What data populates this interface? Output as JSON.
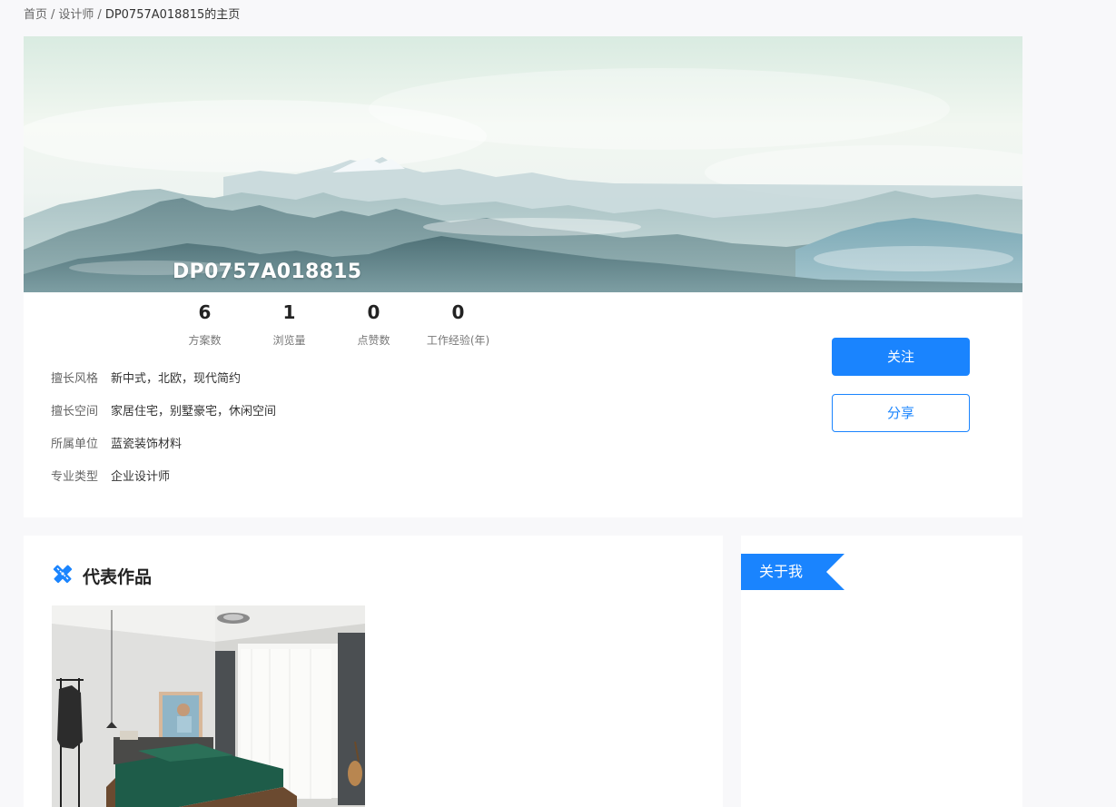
{
  "breadcrumb": {
    "home": "首页",
    "designers": "设计师",
    "current": "DP0757A018815的主页",
    "separator": "/"
  },
  "profile": {
    "name": "DP0757A018815",
    "stats": [
      {
        "value": "6",
        "label": "方案数"
      },
      {
        "value": "1",
        "label": "浏览量"
      },
      {
        "value": "0",
        "label": "点赞数"
      },
      {
        "value": "0",
        "label": "工作经验(年)"
      }
    ],
    "info": [
      {
        "key": "擅长风格",
        "value": "新中式，北欧，现代简约"
      },
      {
        "key": "擅长空间",
        "value": "家居住宅，别墅豪宅，休闲空间"
      },
      {
        "key": "所属单位",
        "value": "蓝瓷装饰材料"
      },
      {
        "key": "专业类型",
        "value": "企业设计师"
      }
    ],
    "follow_label": "关注",
    "share_label": "分享"
  },
  "works": {
    "title": "代表作品"
  },
  "about": {
    "tag": "关于我"
  },
  "colors": {
    "accent": "#1a84fe",
    "page_bg": "#f8f8fa",
    "card_bg": "#ffffff"
  },
  "icons": {
    "works_icon": "pencil-ruler-icon"
  }
}
